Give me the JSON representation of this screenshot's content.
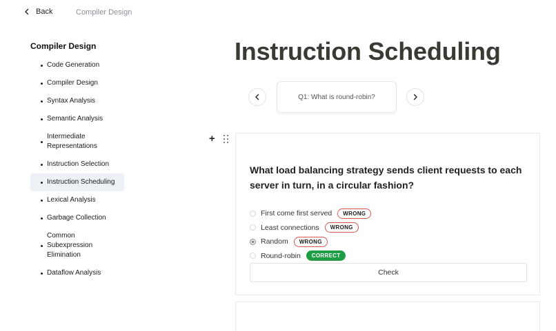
{
  "topbar": {
    "back_label": "Back",
    "breadcrumb": "Compiler Design"
  },
  "sidebar": {
    "title": "Compiler Design",
    "items": [
      {
        "label": "Code Generation",
        "active": false
      },
      {
        "label": "Compiler Design",
        "active": false
      },
      {
        "label": "Syntax Analysis",
        "active": false
      },
      {
        "label": "Semantic Analysis",
        "active": false
      },
      {
        "label": "Intermediate Representations",
        "active": false
      },
      {
        "label": "Instruction Selection",
        "active": false
      },
      {
        "label": "Instruction Scheduling",
        "active": true
      },
      {
        "label": "Lexical Analysis",
        "active": false
      },
      {
        "label": "Garbage Collection",
        "active": false
      },
      {
        "label": "Common Subexpression Elimination",
        "active": false
      },
      {
        "label": "Dataflow Analysis",
        "active": false
      }
    ]
  },
  "main": {
    "title": "Instruction Scheduling",
    "card_tab": "Q1: What is round-robin?",
    "add_symbol": "+",
    "question": {
      "text": "What load balancing strategy sends client requests to each server in turn, in a circular fashion?",
      "options": [
        {
          "label": "First come first served",
          "badge": "WRONG",
          "status": "wrong",
          "selected": false
        },
        {
          "label": "Least connections",
          "badge": "WRONG",
          "status": "wrong",
          "selected": false
        },
        {
          "label": "Random",
          "badge": "WRONG",
          "status": "wrong",
          "selected": true
        },
        {
          "label": "Round-robin",
          "badge": "CORRECT",
          "status": "correct",
          "selected": false
        }
      ],
      "check_label": "Check"
    }
  },
  "colors": {
    "wrong_border": "#d6574f",
    "correct_bg": "#1f9d45",
    "title": "#3b3934",
    "active_item_bg": "#eef1f6"
  },
  "icons": {
    "back": "chevron-left-icon",
    "prev": "chevron-left-icon",
    "next": "chevron-right-icon",
    "add": "plus-icon",
    "drag": "drag-handle-icon"
  }
}
